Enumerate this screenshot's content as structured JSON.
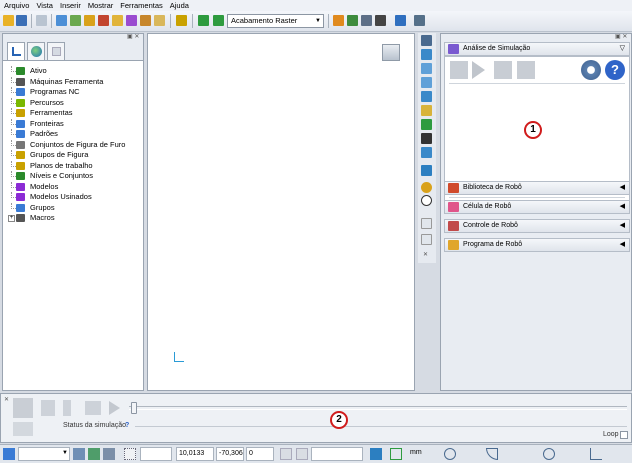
{
  "menu": [
    "Arquivo",
    "Vista",
    "Inserir",
    "Mostrar",
    "Ferramentas",
    "Ajuda"
  ],
  "toolbar": {
    "combo_value": "Acabamento Raster"
  },
  "explorer": {
    "items": [
      {
        "label": "Ativo",
        "icon": "active-icon",
        "color": "#2b8a2b"
      },
      {
        "label": "Máquinas Ferramenta",
        "icon": "machine-tool-icon",
        "color": "#555555"
      },
      {
        "label": "Programas NC",
        "icon": "nc-program-icon",
        "color": "#3a7bd5"
      },
      {
        "label": "Percursos",
        "icon": "toolpath-icon",
        "color": "#7ab800"
      },
      {
        "label": "Ferramentas",
        "icon": "tool-icon",
        "color": "#c9a100"
      },
      {
        "label": "Fronteiras",
        "icon": "boundary-icon",
        "color": "#3a7bd5"
      },
      {
        "label": "Padrões",
        "icon": "pattern-icon",
        "color": "#3a7bd5"
      },
      {
        "label": "Conjuntos de Figura de Furo",
        "icon": "hole-feature-icon",
        "color": "#777777"
      },
      {
        "label": "Grupos de Figura",
        "icon": "feature-group-icon",
        "color": "#c9a100"
      },
      {
        "label": "Planos de trabalho",
        "icon": "workplane-icon",
        "color": "#c9a100"
      },
      {
        "label": "Níveis e Conjuntos",
        "icon": "levels-icon",
        "color": "#2b8a2b"
      },
      {
        "label": "Modelos",
        "icon": "model-icon",
        "color": "#8b2bd5"
      },
      {
        "label": "Modelos Usinados",
        "icon": "stock-model-icon",
        "color": "#8b2bd5"
      },
      {
        "label": "Grupos",
        "icon": "group-icon",
        "color": "#3a7bd5"
      },
      {
        "label": "Macros",
        "icon": "macro-icon",
        "color": "#555555"
      }
    ]
  },
  "right_panel": {
    "simulation_title": "Análise de Simulação",
    "sections": [
      {
        "label": "Biblioteca de Robô",
        "icon": "robot-library-icon"
      },
      {
        "label": "Célula de Robô",
        "icon": "robot-cell-icon"
      },
      {
        "label": "Controle de Robô",
        "icon": "robot-control-icon"
      },
      {
        "label": "Programa de Robô",
        "icon": "robot-program-icon"
      }
    ]
  },
  "bottom": {
    "status_label": "Status da simulação",
    "help_mark": "?",
    "loop_label": "Loop"
  },
  "statusbar": {
    "x": "10,0133",
    "y": "-70,306",
    "z": "0",
    "unit": "mm"
  },
  "callouts": [
    "1",
    "2"
  ],
  "colors": {
    "callout": "#d01c1c",
    "panel_bg": "#e8ecf2"
  }
}
